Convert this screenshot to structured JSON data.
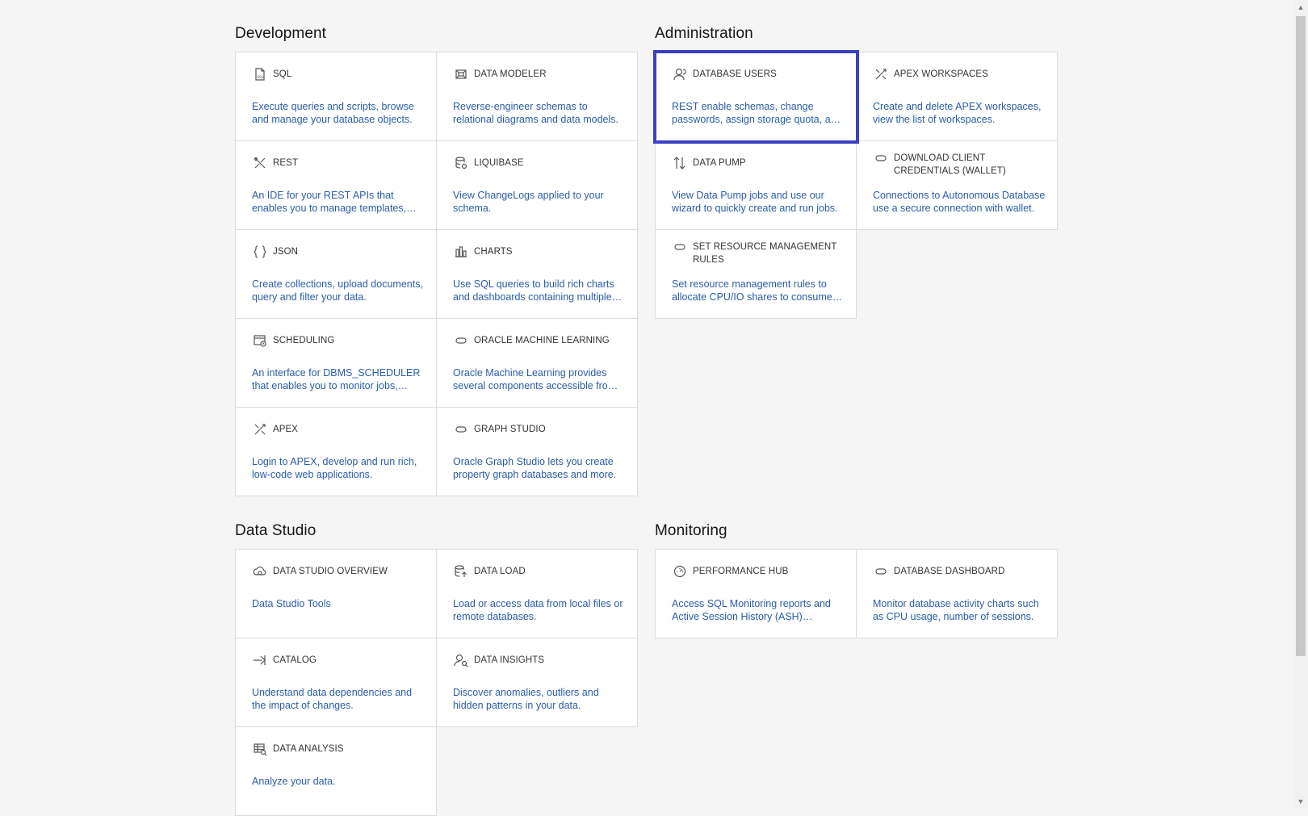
{
  "sections": {
    "development": {
      "title": "Development",
      "cards": [
        {
          "icon": "sql-icon",
          "title": "SQL",
          "desc": "Execute queries and scripts, browse and manage your database objects."
        },
        {
          "icon": "data-modeler-icon",
          "title": "DATA MODELER",
          "desc": "Reverse-engineer schemas to relational diagrams and data models."
        },
        {
          "icon": "rest-icon",
          "title": "REST",
          "desc": "An IDE for your REST APIs that enables you to manage templates, modules and handlers."
        },
        {
          "icon": "liquibase-icon",
          "title": "LIQUIBASE",
          "desc": "View ChangeLogs applied to your schema."
        },
        {
          "icon": "json-icon",
          "title": "JSON",
          "desc": "Create collections, upload documents, query and filter your data."
        },
        {
          "icon": "charts-icon",
          "title": "CHARTS",
          "desc": "Use SQL queries to build rich charts and dashboards containing multiple charts."
        },
        {
          "icon": "scheduling-icon",
          "title": "SCHEDULING",
          "desc": "An interface for DBMS_SCHEDULER that enables you to monitor jobs, programs and schedules."
        },
        {
          "icon": "oracle-machine-learning-icon",
          "title": "ORACLE MACHINE LEARNING",
          "desc": "Oracle Machine Learning provides several components accessible from the web."
        },
        {
          "icon": "apex-icon",
          "title": "APEX",
          "desc": "Login to APEX, develop and run rich, low-code web applications."
        },
        {
          "icon": "graph-studio-icon",
          "title": "GRAPH STUDIO",
          "desc": "Oracle Graph Studio lets you create property graph databases and more."
        }
      ]
    },
    "administration": {
      "title": "Administration",
      "cards": [
        {
          "icon": "database-users-icon",
          "title": "DATABASE USERS",
          "desc": "REST enable schemas, change passwords, assign storage quota, and more."
        },
        {
          "icon": "apex-workspaces-icon",
          "title": "APEX WORKSPACES",
          "desc": "Create and delete APEX workspaces, view the list of workspaces."
        },
        {
          "icon": "data-pump-icon",
          "title": "DATA PUMP",
          "desc": "View Data Pump jobs and use our wizard to quickly create and run jobs."
        },
        {
          "icon": "download-client-credentials-icon",
          "title": "DOWNLOAD CLIENT CREDENTIALS (WALLET)",
          "desc": "Connections to Autonomous Database use a secure connection with wallet."
        },
        {
          "icon": "set-resource-management-rules-icon",
          "title": "SET RESOURCE MANAGEMENT RULES",
          "desc": "Set resource management rules to allocate CPU/IO shares to consumer groups."
        }
      ]
    },
    "data_studio": {
      "title": "Data Studio",
      "cards": [
        {
          "icon": "data-studio-overview-icon",
          "title": "DATA STUDIO OVERVIEW",
          "desc": "Data Studio Tools"
        },
        {
          "icon": "data-load-icon",
          "title": "DATA LOAD",
          "desc": "Load or access data from local files or remote databases."
        },
        {
          "icon": "catalog-icon",
          "title": "CATALOG",
          "desc": "Understand data dependencies and the impact of changes."
        },
        {
          "icon": "data-insights-icon",
          "title": "DATA INSIGHTS",
          "desc": "Discover anomalies, outliers and hidden patterns in your data."
        },
        {
          "icon": "data-analysis-icon",
          "title": "DATA ANALYSIS",
          "desc": "Analyze your data."
        }
      ]
    },
    "monitoring": {
      "title": "Monitoring",
      "cards": [
        {
          "icon": "performance-hub-icon",
          "title": "PERFORMANCE HUB",
          "desc": "Access SQL Monitoring reports and Active Session History (ASH) analytics."
        },
        {
          "icon": "database-dashboard-icon",
          "title": "DATABASE DASHBOARD",
          "desc": "Monitor database activity charts such as CPU usage, number of sessions."
        }
      ]
    }
  },
  "selected_card": "DATABASE USERS",
  "colors": {
    "accent": "#3c3fc3",
    "link": "#2a5dab",
    "background": "#f5f5f5",
    "card": "#ffffff",
    "border": "#dcdcdc"
  }
}
